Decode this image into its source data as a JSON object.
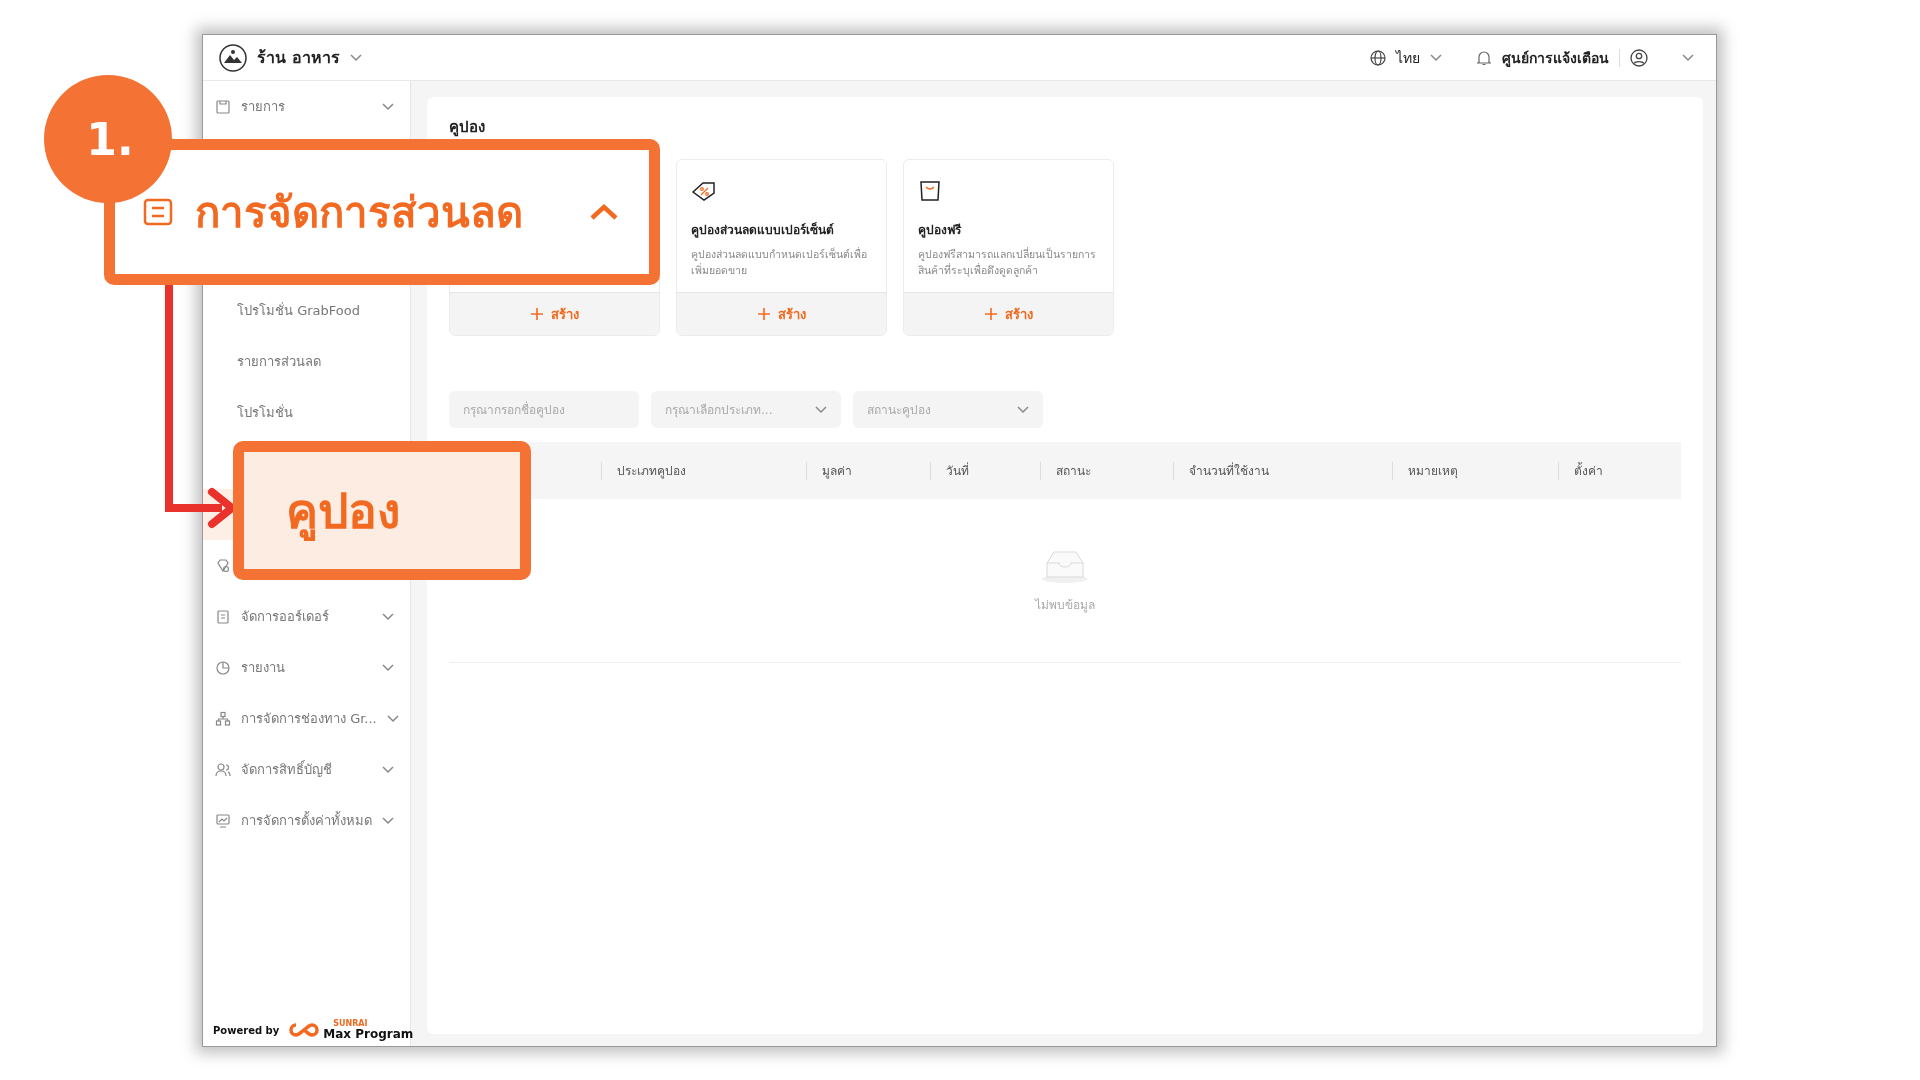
{
  "header": {
    "store_name": "ร้าน อาหาร",
    "language": "ไทย",
    "notifications": "ศูนย์การแจ้งเตือน"
  },
  "sidebar": {
    "items": [
      {
        "kind": "group",
        "label": "รายการ",
        "expanded": false
      },
      {
        "kind": "group"
      },
      {
        "kind": "sub"
      },
      {
        "kind": "sub"
      },
      {
        "kind": "sub",
        "label": "โปรโมชั่น GrabFood",
        "selected": false
      },
      {
        "kind": "sub",
        "label": "รายการส่วนลด",
        "selected": false
      },
      {
        "kind": "sub",
        "label": "โปรโมชั่น",
        "selected": false
      },
      {
        "kind": "sub"
      },
      {
        "kind": "sub",
        "selected": true
      },
      {
        "kind": "group"
      },
      {
        "kind": "group",
        "label": "จัดการออร์เดอร์",
        "expanded": false
      },
      {
        "kind": "group",
        "label": "รายงาน",
        "expanded": false
      },
      {
        "kind": "group",
        "label": "การจัดการช่องทาง Gr...",
        "expanded": false
      },
      {
        "kind": "group",
        "label": "จัดการสิทธิ์บัญชี",
        "expanded": false
      },
      {
        "kind": "group",
        "label": "การจัดการตั้งค่าทั้งหมด",
        "expanded": false
      }
    ],
    "footer": {
      "powered_by": "Powered by",
      "brand_small": "SUNRAI",
      "brand": "Max Program"
    }
  },
  "main": {
    "title": "คูปอง",
    "coupon_types": [
      {
        "create_label": "สร้าง"
      },
      {
        "title": "คูปองส่วนลดแบบเปอร์เซ็นต์",
        "description": "คูปองส่วนลดแบบกำหนดเปอร์เซ็นต์เพื่อเพิ่มยอดขาย",
        "create_label": "สร้าง"
      },
      {
        "title": "คูปองฟรี",
        "description": "คูปองฟรีสามารถแลกเปลี่ยนเป็นรายการสินค้าที่ระบุเพื่อดึงดูดลูกค้า",
        "create_label": "สร้าง"
      }
    ],
    "filters": [
      {
        "kind": "input",
        "placeholder": "กรุณากรอกชื่อคูปอง"
      },
      {
        "kind": "select",
        "placeholder": "กรุณาเลือกประเภท..."
      },
      {
        "kind": "select",
        "placeholder": "สถานะคูปอง"
      }
    ],
    "table": {
      "columns": [
        {},
        {
          "label": "ประเภทคูปอง"
        },
        {
          "label": "มูลค่า"
        },
        {
          "label": "วันที่"
        },
        {
          "label": "สถานะ"
        },
        {
          "label": "จำนวนที่ใช้งาน"
        },
        {
          "label": "หมายเหตุ"
        },
        {
          "label": "ตั้งค่า"
        }
      ],
      "empty_text": "ไม่พบข้อมูล"
    }
  },
  "annotation": {
    "step": "1.",
    "callouts": [
      {
        "kind": "menu-group",
        "label": "การจัดการส่วนลด",
        "expanded": true
      },
      {
        "kind": "menu-item",
        "label": "คูปอง",
        "selected": true
      }
    ]
  }
}
